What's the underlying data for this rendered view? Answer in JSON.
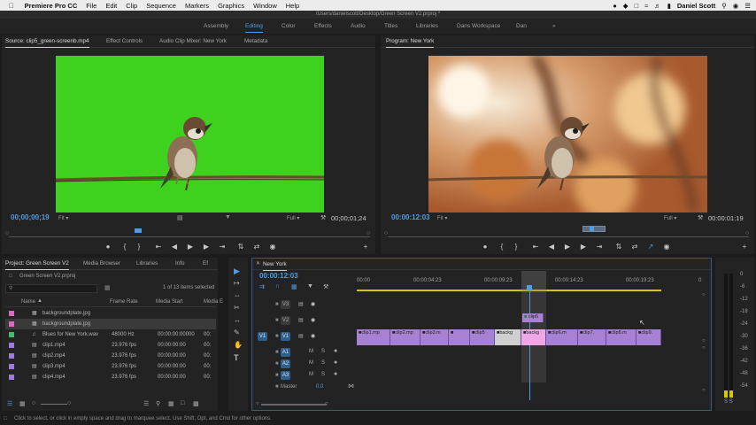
{
  "menubar": {
    "app": "Premiere Pro CC",
    "items": [
      "File",
      "Edit",
      "Clip",
      "Sequence",
      "Markers",
      "Graphics",
      "Window",
      "Help"
    ],
    "user": "Daniel Scott"
  },
  "title": "/Users/danielscott/Desktop/Green Screen V2.prproj *",
  "workspaces": [
    "Assembly",
    "Editing",
    "Color",
    "Effects",
    "Audio",
    "Titles",
    "Libraries",
    "Dans Workspace",
    "Dan"
  ],
  "workspace_active": "Editing",
  "more_glyph": "»",
  "source": {
    "tabs": [
      "Source: clip5_green-screenb.mp4",
      "Effect Controls",
      "Audio Clip Mixer: New York",
      "Metadata"
    ],
    "timecode": "00;00;00;19",
    "fit": "Fit",
    "quality": "Full",
    "duration": "00;00;01;24"
  },
  "program": {
    "tab": "Program: New York",
    "timecode": "00:00:12:03",
    "fit": "Fit",
    "quality": "Full",
    "duration": "00:00:01:19"
  },
  "project": {
    "tabs": [
      "Project: Green Screen V2",
      "Media Browser",
      "Libraries",
      "Info",
      "Ef"
    ],
    "file": "Green Screen V2.prproj",
    "selection": "1 of 13 items selected",
    "columns": [
      "Name",
      "Frame Rate",
      "Media Start",
      "Media E"
    ],
    "rows": [
      {
        "name": "backgroundplate.jpg",
        "rate": "",
        "start": "",
        "color": "#d66bc6",
        "sel": false
      },
      {
        "name": "backgroundplate.jpg",
        "rate": "",
        "start": "",
        "color": "#d66bc6",
        "sel": true
      },
      {
        "name": "Blues for New York.wav",
        "rate": "48000 Hz",
        "start": "00:00:00:00000",
        "color": "#3fbf6b",
        "sel": false
      },
      {
        "name": "clip1.mp4",
        "rate": "23.976 fps",
        "start": "00:00:00:00",
        "color": "#9f7be0",
        "sel": false
      },
      {
        "name": "clip2.mp4",
        "rate": "23.976 fps",
        "start": "00:00:00:00",
        "color": "#9f7be0",
        "sel": false
      },
      {
        "name": "clip3.mp4",
        "rate": "23.976 fps",
        "start": "00:00:00:00",
        "color": "#9f7be0",
        "sel": false
      },
      {
        "name": "clip4.mp4",
        "rate": "23.976 fps",
        "start": "00:00:00:00",
        "color": "#9f7be0",
        "sel": false
      }
    ]
  },
  "timeline": {
    "tab": "New York",
    "timecode": "00:00:12:03",
    "ruler": [
      "00:00",
      "00:00:04:23",
      "00:00:09:23",
      "00:00:14:23",
      "00:00:19:23",
      "0"
    ],
    "tracks_video": [
      "V3",
      "V2",
      "V1"
    ],
    "tracks_audio": [
      "A1",
      "A2",
      "A3"
    ],
    "master_label": "Master",
    "master_value": "0.0",
    "v2_clip": "clip5",
    "v1_clips": [
      "clip1.mp",
      "clip2.mp",
      "clip3.m",
      "",
      "clip5",
      "backg",
      "backg",
      "clip6.m",
      "clip7.",
      "clip8.m",
      "clip9."
    ]
  },
  "meter": {
    "labels": [
      "0",
      "-6",
      "-12",
      "-18",
      "-24",
      "-30",
      "-36",
      "-42",
      "-48",
      "-54"
    ],
    "bottom": "S S",
    "top": "dB"
  },
  "status": "Click to select, or click in empty space and drag to marquee select. Use Shift, Opt, and Cmd for other options.",
  "icons": {
    "apple": "apple-icon",
    "wifi": "wifi-icon",
    "search": "search-icon",
    "folder": "folder-icon",
    "play": "play-icon",
    "marker": "marker-icon"
  }
}
